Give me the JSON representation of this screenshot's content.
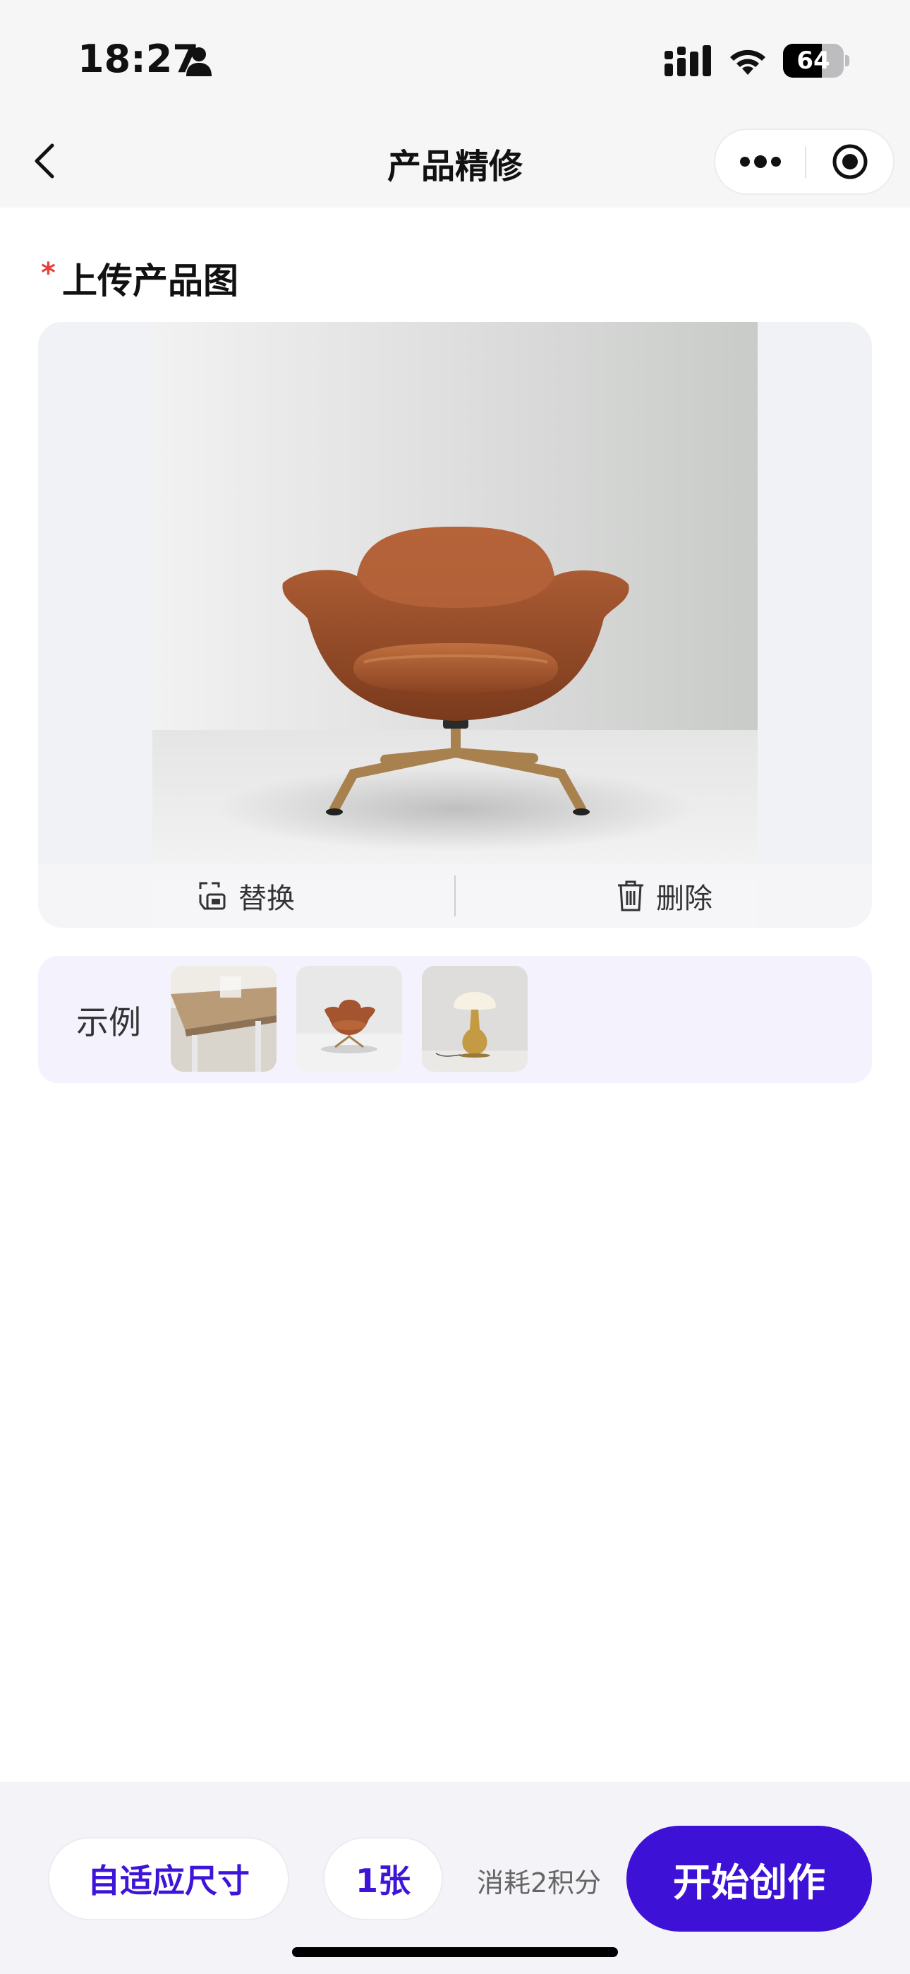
{
  "status_bar": {
    "time": "18:27",
    "battery_level": "64",
    "icons": [
      "person-icon",
      "cellular-signal-icon",
      "wifi-icon",
      "battery-icon"
    ]
  },
  "nav": {
    "title": "产品精修",
    "icons": [
      "back-chevron-icon",
      "more-dots-icon",
      "close-target-icon"
    ]
  },
  "upload": {
    "required_mark": "*",
    "title": "上传产品图",
    "replace_label": "替换",
    "delete_label": "删除",
    "icons": [
      "replace-icon",
      "trash-icon"
    ]
  },
  "examples": {
    "label": "示例"
  },
  "bottom": {
    "size_label": "自适应尺寸",
    "count_label": "1张",
    "cost_text": "消耗2积分",
    "create_label": "开始创作"
  },
  "colors": {
    "accent": "#3d12d6",
    "required": "#e3403a",
    "example_bg": "#f4f2fd"
  }
}
